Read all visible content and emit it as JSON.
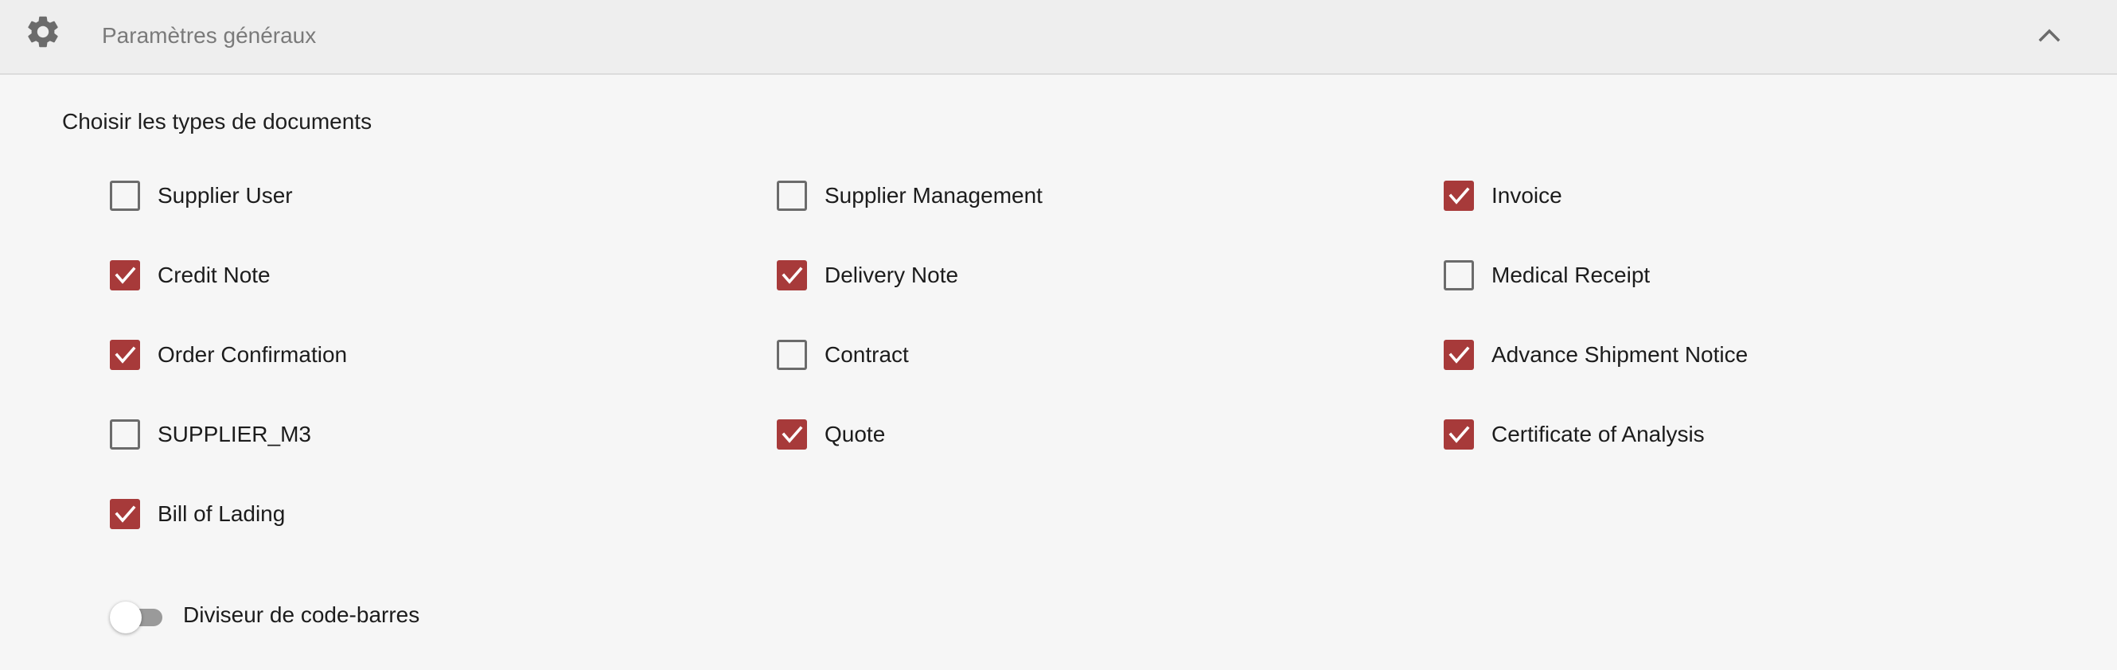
{
  "header": {
    "title": "Paramètres généraux",
    "icon": "gear-icon",
    "collapse_icon": "chevron-up-icon",
    "icon_color": "#6b6b6b"
  },
  "section": {
    "title": "Choisir les types de documents"
  },
  "checkbox_color": "#a73a3a",
  "document_types": [
    {
      "label": "Supplier User",
      "checked": false
    },
    {
      "label": "Supplier Management",
      "checked": false
    },
    {
      "label": "Invoice",
      "checked": true
    },
    {
      "label": "Credit Note",
      "checked": true
    },
    {
      "label": "Delivery Note",
      "checked": true
    },
    {
      "label": "Medical Receipt",
      "checked": false
    },
    {
      "label": "Order Confirmation",
      "checked": true
    },
    {
      "label": "Contract",
      "checked": false
    },
    {
      "label": "Advance Shipment Notice",
      "checked": true
    },
    {
      "label": "SUPPLIER_M3",
      "checked": false
    },
    {
      "label": "Quote",
      "checked": true
    },
    {
      "label": "Certificate of Analysis",
      "checked": true
    },
    {
      "label": "Bill of Lading",
      "checked": true
    }
  ],
  "barcode_splitter": {
    "label": "Diviseur de code-barres",
    "enabled": false
  }
}
